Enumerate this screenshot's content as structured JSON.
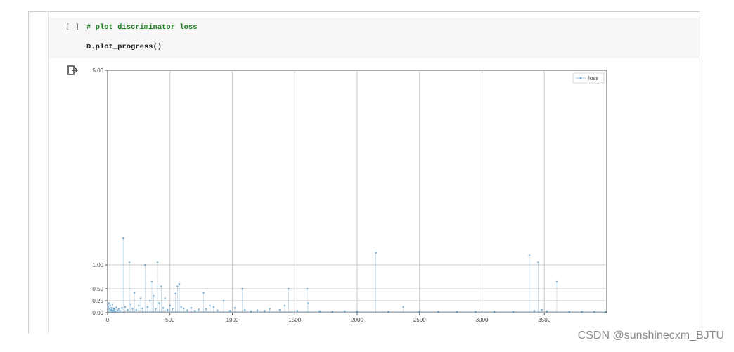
{
  "notebook": {
    "run_indicator": "[ ]",
    "code_comment": "# plot discriminator loss",
    "code_call": "D.plot_progress()",
    "output_icon": "output-arrow-icon"
  },
  "chart_data": {
    "type": "scatter",
    "title": "",
    "xlabel": "",
    "ylabel": "",
    "xlim": [
      0,
      4000
    ],
    "ylim": [
      0,
      5
    ],
    "y_scale": "piecewise",
    "xticks": [
      "0",
      "500",
      "1000",
      "1500",
      "2000",
      "2500",
      "3000",
      "3500"
    ],
    "xtick_values": [
      0,
      500,
      1000,
      1500,
      2000,
      2500,
      3000,
      3500
    ],
    "yticks": [
      "0.00",
      "0.25",
      "0.50",
      "1.00",
      "5.00"
    ],
    "ytick_values": [
      0,
      0.25,
      0.5,
      1,
      5
    ],
    "grid": true,
    "legend_position": "top-right",
    "series": [
      {
        "name": "loss",
        "color": "#1f77b4",
        "x": [
          5,
          10,
          15,
          20,
          25,
          30,
          35,
          40,
          45,
          50,
          55,
          60,
          70,
          80,
          90,
          100,
          115,
          125,
          140,
          160,
          175,
          185,
          200,
          215,
          230,
          250,
          265,
          280,
          300,
          320,
          340,
          355,
          370,
          385,
          400,
          415,
          430,
          445,
          460,
          480,
          500,
          520,
          545,
          560,
          575,
          590,
          610,
          640,
          670,
          700,
          730,
          770,
          790,
          820,
          850,
          880,
          930,
          980,
          1020,
          1080,
          1100,
          1150,
          1200,
          1260,
          1300,
          1380,
          1420,
          1450,
          1520,
          1600,
          1610,
          1700,
          1800,
          1900,
          2000,
          2150,
          2250,
          2370,
          2500,
          2650,
          2800,
          2950,
          3100,
          3250,
          3380,
          3420,
          3450,
          3480,
          3520,
          3600,
          3700,
          3800,
          3900,
          3990
        ],
        "y": [
          0.12,
          0.2,
          0.08,
          0.15,
          0.05,
          0.1,
          0.06,
          0.18,
          0.04,
          0.09,
          0.07,
          0.03,
          0.11,
          0.05,
          0.08,
          0.04,
          0.1,
          1.55,
          0.12,
          0.06,
          1.05,
          0.18,
          0.08,
          0.42,
          0.06,
          0.15,
          0.3,
          0.09,
          1.0,
          0.12,
          0.25,
          0.65,
          0.35,
          0.08,
          1.05,
          0.2,
          0.55,
          0.1,
          0.3,
          0.06,
          0.15,
          0.08,
          0.4,
          0.55,
          0.6,
          0.12,
          0.09,
          0.05,
          0.1,
          0.04,
          0.07,
          0.42,
          0.08,
          0.15,
          0.12,
          0.05,
          0.25,
          0.04,
          0.1,
          0.5,
          0.06,
          0.03,
          0.05,
          0.04,
          0.08,
          0.06,
          0.15,
          0.5,
          0.04,
          0.5,
          0.2,
          0.03,
          0.02,
          0.03,
          0.02,
          1.25,
          0.02,
          0.12,
          0.02,
          0.02,
          0.02,
          0.02,
          0.02,
          0.02,
          1.2,
          0.04,
          1.05,
          0.06,
          0.03,
          0.65,
          0.02,
          0.02,
          0.02,
          0.02
        ]
      }
    ]
  },
  "watermark": "CSDN @sunshinecxm_BJTU"
}
